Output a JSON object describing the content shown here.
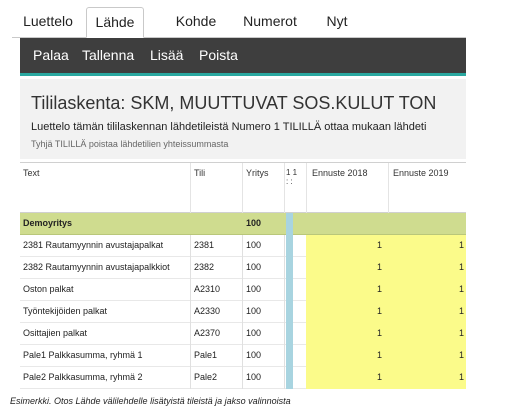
{
  "tabs": [
    {
      "label": "Luettelo",
      "active": false
    },
    {
      "label": "Lähde",
      "active": true
    },
    {
      "label": "Kohde",
      "active": false
    },
    {
      "label": "Numerot",
      "active": false
    },
    {
      "label": "Nyt",
      "active": false
    }
  ],
  "toolbar": {
    "back_label": "Palaa",
    "save_label": "Tallenna",
    "add_label": "Lisää",
    "delete_label": "Poista"
  },
  "header": {
    "title": "Tililaskenta: SKM, MUUTTUVAT SOS.KULUT TON",
    "description": "Luettelo tämän tililaskennan lähdetileistä Numero 1 TILILLÄ ottaa mukaan lähdeti",
    "hint": "Tyhjä TILILLÄ poistaa lähdetilien yhteissummasta"
  },
  "columns": {
    "text": "Text",
    "account": "Tili",
    "company": "Yritys",
    "flags_top": "1 1",
    "flags_bottom": ": :",
    "forecast_2018": "Ennuste 2018",
    "forecast_2019": "Ennuste 2019"
  },
  "group": {
    "text": "Demoyritys",
    "company": "100"
  },
  "rows": [
    {
      "text": "2381 Rautamyynnin avustajapalkat",
      "account": "2381",
      "company": "100",
      "f2018": "1",
      "f2019": "1"
    },
    {
      "text": "2382 Rautamyynnin avustajapalkkiot",
      "account": "2382",
      "company": "100",
      "f2018": "1",
      "f2019": "1"
    },
    {
      "text": "Oston palkat",
      "account": "A2310",
      "company": "100",
      "f2018": "1",
      "f2019": "1"
    },
    {
      "text": "Työntekijöiden palkat",
      "account": "A2330",
      "company": "100",
      "f2018": "1",
      "f2019": "1"
    },
    {
      "text": "Osittajien palkat",
      "account": "A2370",
      "company": "100",
      "f2018": "1",
      "f2019": "1"
    },
    {
      "text": "Pale1 Palkkasumma, ryhmä 1",
      "account": "Pale1",
      "company": "100",
      "f2018": "1",
      "f2019": "1"
    },
    {
      "text": "Pale2 Palkkasumma, ryhmä 2",
      "account": "Pale2",
      "company": "100",
      "f2018": "1",
      "f2019": "1"
    }
  ],
  "caption": "Esimerkki. Otos Lähde välilehdelle lisätyistä tileistä ja jakso valinnoista",
  "colors": {
    "toolbar_bg": "#3e3e3e",
    "toolbar_accent": "#2aa8a0",
    "group_row": "#cfdc8f",
    "input_cell": "#fbfb8a",
    "flag_bar": "#a8d4e0"
  }
}
